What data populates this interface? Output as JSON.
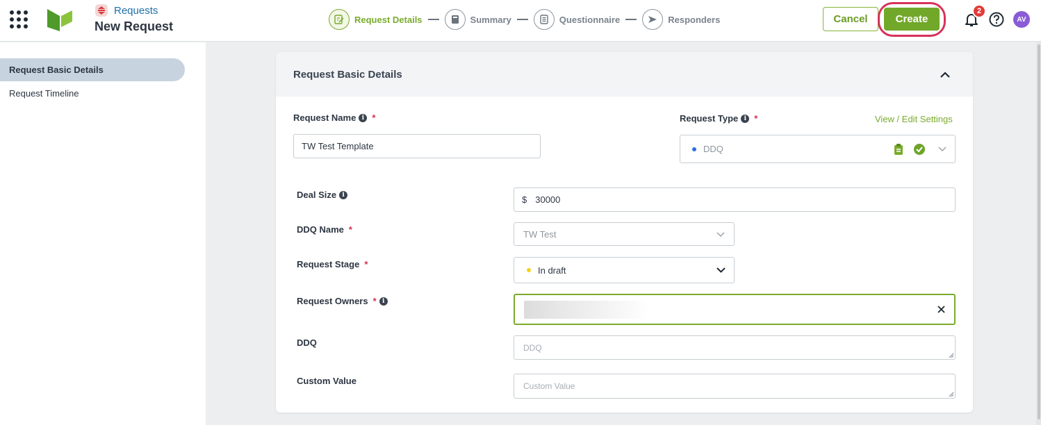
{
  "header": {
    "breadcrumb_label": "Requests",
    "page_title": "New Request",
    "steps": [
      {
        "label": "Request Details",
        "active": true
      },
      {
        "label": "Summary",
        "active": false
      },
      {
        "label": "Questionnaire",
        "active": false
      },
      {
        "label": "Responders",
        "active": false
      }
    ],
    "cancel_label": "Cancel",
    "create_label": "Create",
    "notification_count": "2",
    "avatar_initials": "AV"
  },
  "sidebar": {
    "items": [
      {
        "label": "Request Basic Details",
        "active": true
      },
      {
        "label": "Request Timeline",
        "active": false
      }
    ]
  },
  "form": {
    "section_title": "Request Basic Details",
    "request_name": {
      "label": "Request Name",
      "value": "TW Test Template"
    },
    "request_type": {
      "label": "Request Type",
      "value": "DDQ",
      "dot_color": "#2f6fe0"
    },
    "view_edit_settings": "View / Edit Settings",
    "deal_size": {
      "label": "Deal Size",
      "currency": "$",
      "value": "30000"
    },
    "ddq_name": {
      "label": "DDQ Name",
      "value": "TW Test"
    },
    "request_stage": {
      "label": "Request Stage",
      "value": "In draft",
      "dot_color": "#f2d21b"
    },
    "request_owners": {
      "label": "Request Owners"
    },
    "ddq": {
      "label": "DDQ",
      "placeholder": "DDQ"
    },
    "custom_value": {
      "label": "Custom Value",
      "placeholder": "Custom Value"
    }
  },
  "colors": {
    "accent": "#72a82a",
    "link": "#7aab2d",
    "highlight_ring": "#d7325a",
    "required": "#d62f4b"
  }
}
